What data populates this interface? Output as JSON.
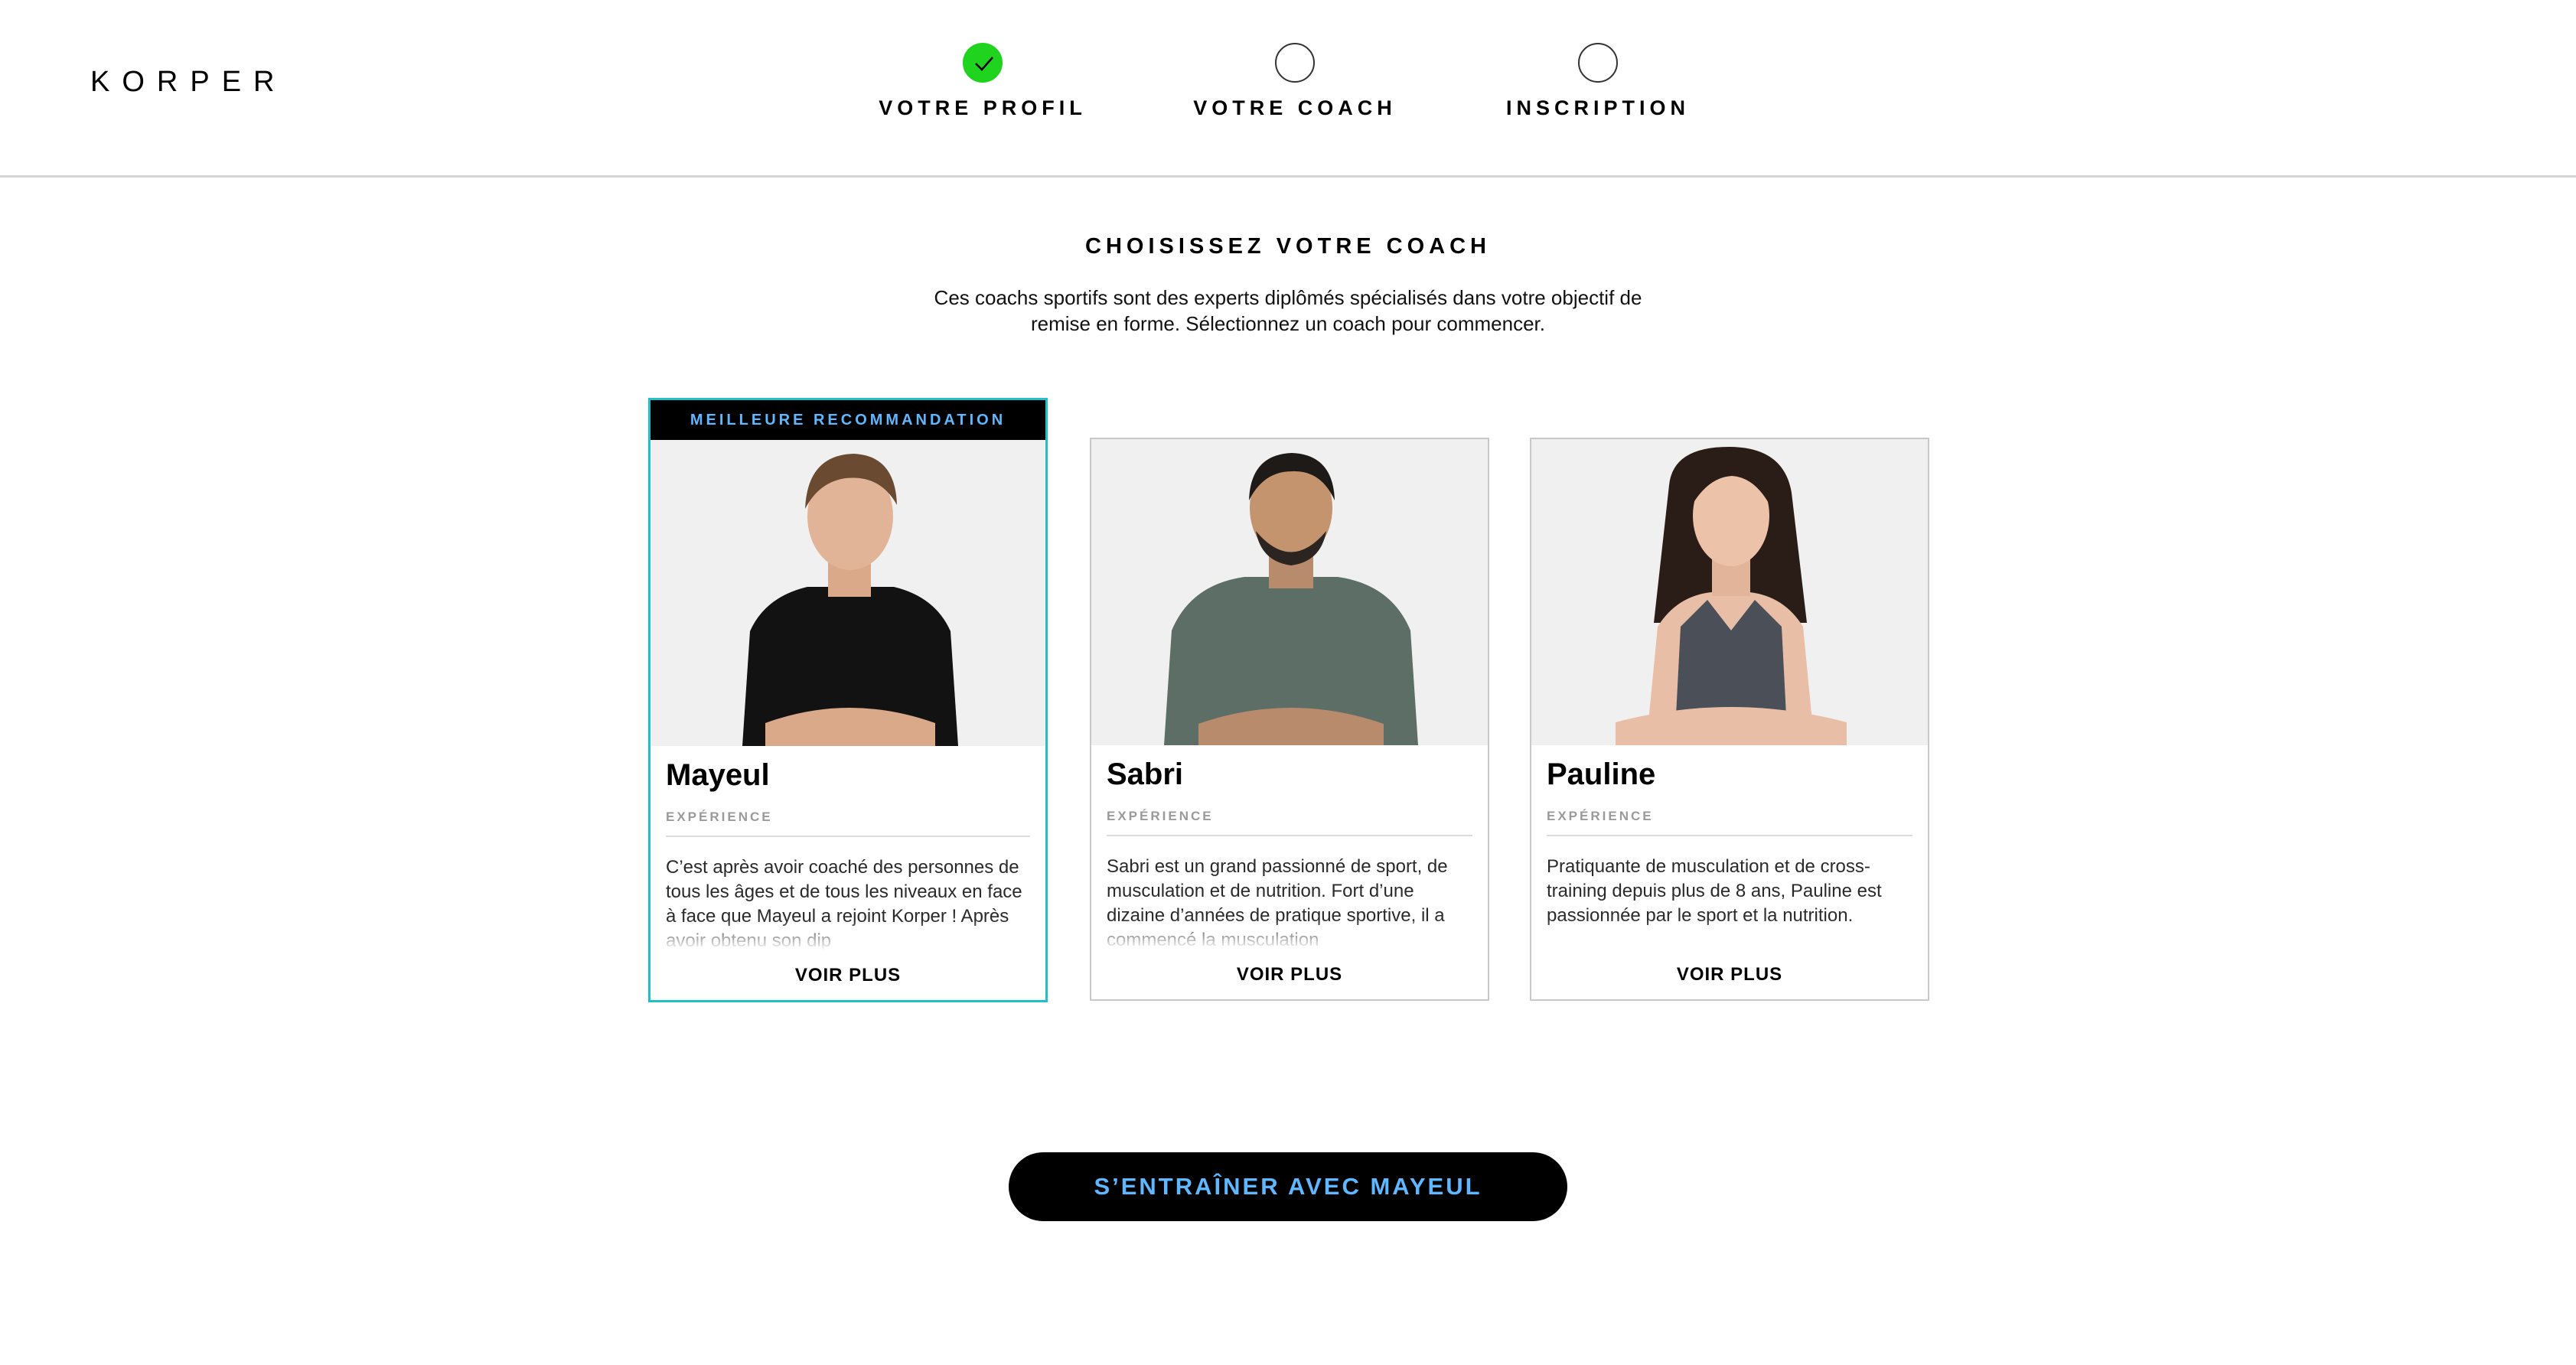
{
  "brand": {
    "logo": "KORPER"
  },
  "steps": [
    {
      "label": "VOTRE PROFIL",
      "status": "done"
    },
    {
      "label": "VOTRE COACH",
      "status": "pending"
    },
    {
      "label": "INSCRIPTION",
      "status": "pending"
    }
  ],
  "main": {
    "title": "CHOISISSEZ VOTRE COACH",
    "subtitle": "Ces coachs sportifs sont des experts diplômés spécialisés dans votre objectif de remise en forme. Sélectionnez un coach pour commencer."
  },
  "coaches": [
    {
      "badge": "MEILLEURE RECOMMANDATION",
      "name": "Mayeul",
      "experience_label": "EXPÉRIENCE",
      "description": "C’est après avoir coaché des personnes de tous les âges et de tous les niveaux en face à face que Mayeul a rejoint Korper ! Après avoir obtenu son dip",
      "more": "VOIR PLUS",
      "selected": true
    },
    {
      "name": "Sabri",
      "experience_label": "EXPÉRIENCE",
      "description": "Sabri est un grand passionné de sport, de musculation et de nutrition. Fort d’une dizaine d’années de pratique sportive, il a commencé la musculation",
      "more": "VOIR PLUS",
      "selected": false
    },
    {
      "name": "Pauline",
      "experience_label": "EXPÉRIENCE",
      "description": "Pratiquante de musculation et de cross-training depuis plus de 8 ans, Pauline est passionnée par le sport et la nutrition.",
      "more": "VOIR PLUS",
      "selected": false
    }
  ],
  "cta": {
    "label": "S’ENTRAÎNER AVEC MAYEUL"
  },
  "colors": {
    "accent": "#22c1c9",
    "cta_text": "#5fb8ff",
    "step_done": "#1fd31f"
  }
}
